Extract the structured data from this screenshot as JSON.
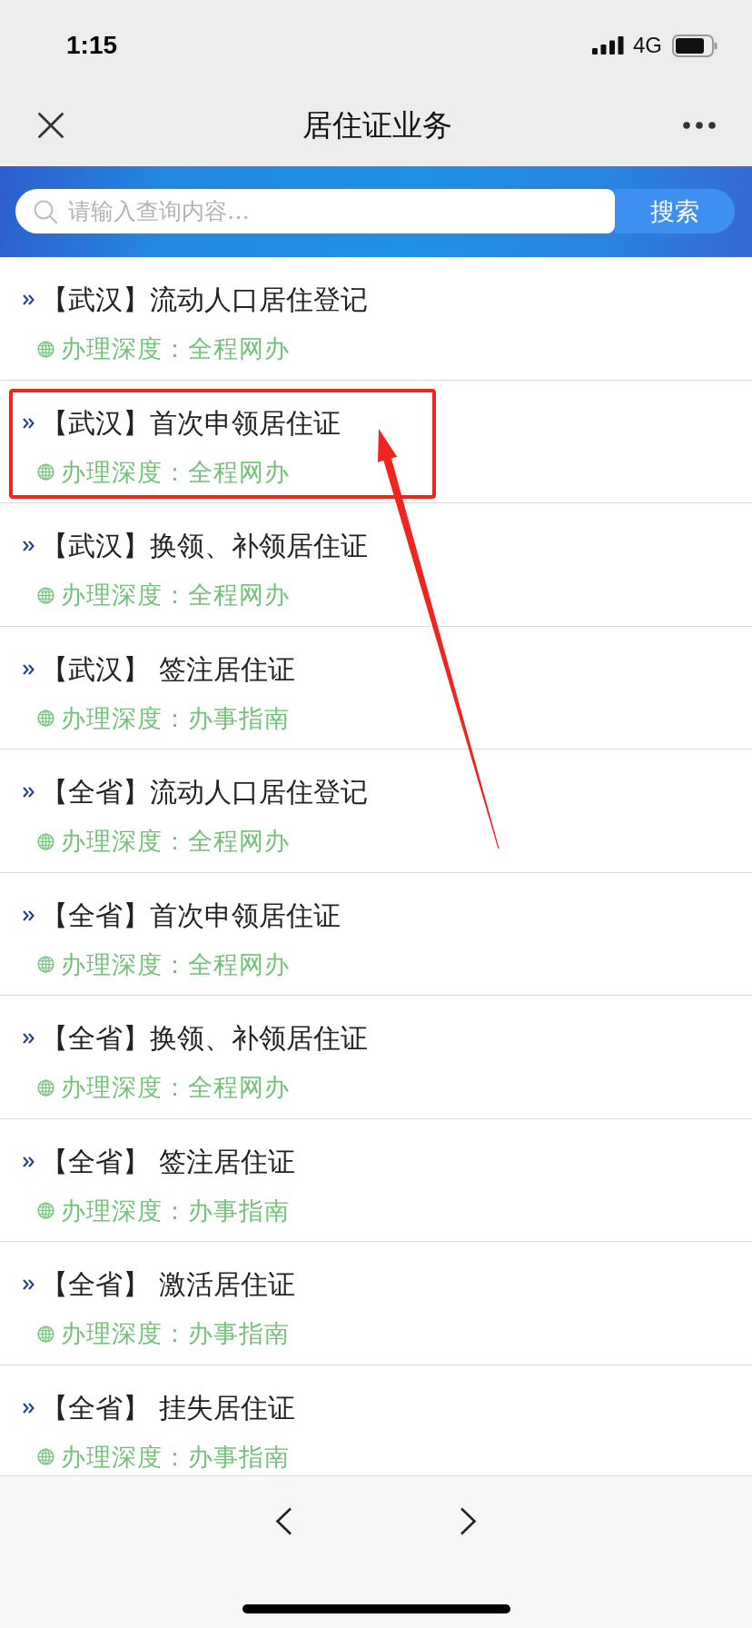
{
  "status_bar": {
    "time": "1:15",
    "network": "4G"
  },
  "nav_bar": {
    "title": "居住证业务"
  },
  "search": {
    "placeholder": "请输入查询内容…",
    "button": "搜索"
  },
  "items": [
    {
      "title": "【武汉】流动人口居住登记",
      "depth": "办理深度：全程网办",
      "highlighted": false
    },
    {
      "title": "【武汉】首次申领居住证",
      "depth": "办理深度：全程网办",
      "highlighted": true
    },
    {
      "title": "【武汉】换领、补领居住证",
      "depth": "办理深度：全程网办",
      "highlighted": false
    },
    {
      "title": "【武汉】 签注居住证",
      "depth": "办理深度：办事指南",
      "highlighted": false
    },
    {
      "title": "【全省】流动人口居住登记",
      "depth": "办理深度：全程网办",
      "highlighted": false
    },
    {
      "title": "【全省】首次申领居住证",
      "depth": "办理深度：全程网办",
      "highlighted": false
    },
    {
      "title": "【全省】换领、补领居住证",
      "depth": "办理深度：全程网办",
      "highlighted": false
    },
    {
      "title": "【全省】 签注居住证",
      "depth": "办理深度：办事指南",
      "highlighted": false
    },
    {
      "title": "【全省】 激活居住证",
      "depth": "办理深度：办事指南",
      "highlighted": false
    },
    {
      "title": "【全省】 挂失居住证",
      "depth": "办理深度：办事指南",
      "highlighted": false
    }
  ]
}
